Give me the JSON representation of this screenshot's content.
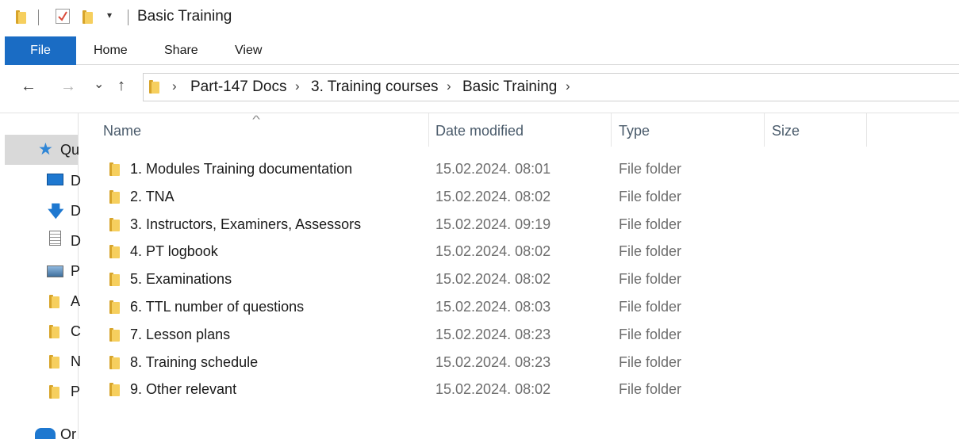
{
  "window": {
    "title": "Basic Training"
  },
  "ribbon": {
    "tabs": [
      "File",
      "Home",
      "Share",
      "View"
    ]
  },
  "nav": {
    "back": "←",
    "forward": "→",
    "recent": "⌄",
    "up": "↑"
  },
  "address": {
    "crumbs": [
      "Part-147 Docs",
      "3. Training courses",
      "Basic Training"
    ]
  },
  "sidebar": {
    "items": [
      {
        "icon": "star-icon",
        "label": "Qu"
      },
      {
        "icon": "desktop-icon",
        "label": "D"
      },
      {
        "icon": "download-icon",
        "label": "D"
      },
      {
        "icon": "document-icon",
        "label": "D"
      },
      {
        "icon": "pictures-icon",
        "label": "P"
      },
      {
        "icon": "folder-icon",
        "label": "A"
      },
      {
        "icon": "folder-icon",
        "label": "C"
      },
      {
        "icon": "folder-icon",
        "label": "N"
      },
      {
        "icon": "folder-icon",
        "label": "P"
      },
      {
        "icon": "onedrive-icon",
        "label": "Or"
      }
    ]
  },
  "columns": {
    "name": "Name",
    "date": "Date modified",
    "type": "Type",
    "size": "Size"
  },
  "files": [
    {
      "name": "1. Modules Training documentation",
      "date": "15.02.2024. 08:01",
      "type": "File folder",
      "size": ""
    },
    {
      "name": "2. TNA",
      "date": "15.02.2024. 08:02",
      "type": "File folder",
      "size": ""
    },
    {
      "name": "3. Instructors, Examiners, Assessors",
      "date": "15.02.2024. 09:19",
      "type": "File folder",
      "size": ""
    },
    {
      "name": "4. PT logbook",
      "date": "15.02.2024. 08:02",
      "type": "File folder",
      "size": ""
    },
    {
      "name": "5. Examinations",
      "date": "15.02.2024. 08:02",
      "type": "File folder",
      "size": ""
    },
    {
      "name": "6. TTL number of questions",
      "date": "15.02.2024. 08:03",
      "type": "File folder",
      "size": ""
    },
    {
      "name": "7. Lesson plans",
      "date": "15.02.2024. 08:23",
      "type": "File folder",
      "size": ""
    },
    {
      "name": "8. Training schedule",
      "date": "15.02.2024. 08:23",
      "type": "File folder",
      "size": ""
    },
    {
      "name": "9. Other relevant",
      "date": "15.02.2024. 08:02",
      "type": "File folder",
      "size": ""
    }
  ]
}
